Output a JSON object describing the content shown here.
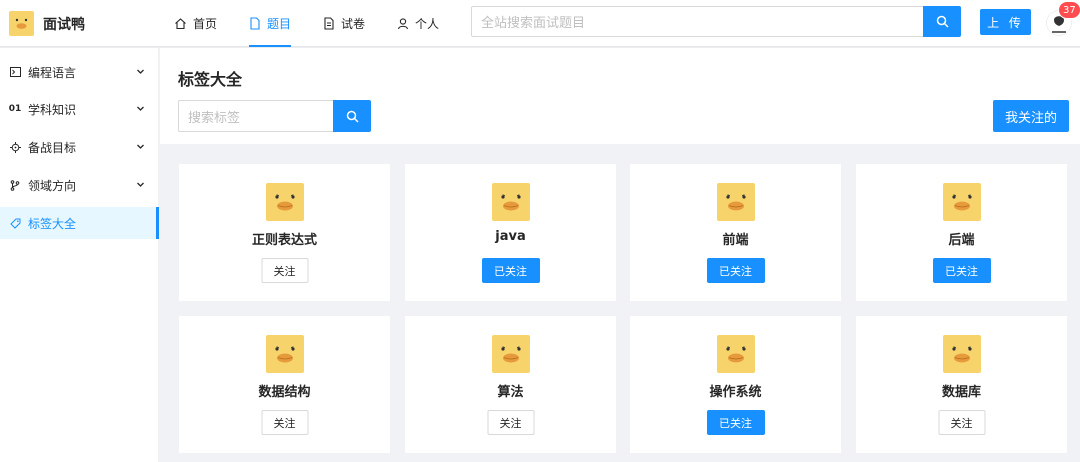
{
  "app": {
    "name": "面试鸭"
  },
  "nav": [
    {
      "label": "首页",
      "icon": "home-icon",
      "active": false
    },
    {
      "label": "题目",
      "icon": "file-icon",
      "active": true
    },
    {
      "label": "试卷",
      "icon": "paper-icon",
      "active": false
    },
    {
      "label": "个人",
      "icon": "user-icon",
      "active": false
    }
  ],
  "search": {
    "placeholder": "全站搜索面试题目"
  },
  "upload_label": "上 传",
  "notification_count": "37",
  "sidebar": [
    {
      "label": "编程语言",
      "icon": "terminal-icon",
      "expandable": true
    },
    {
      "label": "学科知识",
      "icon": "01",
      "expandable": true
    },
    {
      "label": "备战目标",
      "icon": "target-icon",
      "expandable": true
    },
    {
      "label": "领域方向",
      "icon": "branch-icon",
      "expandable": true
    },
    {
      "label": "标签大全",
      "icon": "tag-icon",
      "expandable": false,
      "active": true
    }
  ],
  "page_title": "标签大全",
  "tag_search": {
    "placeholder": "搜索标签"
  },
  "my_follows_label": "我关注的",
  "tags": [
    {
      "name": "正则表达式",
      "button": "关注",
      "followed": false
    },
    {
      "name": "java",
      "button": "已关注",
      "followed": true
    },
    {
      "name": "前端",
      "button": "已关注",
      "followed": true
    },
    {
      "name": "后端",
      "button": "已关注",
      "followed": true
    },
    {
      "name": "数据结构",
      "button": "关注",
      "followed": false
    },
    {
      "name": "算法",
      "button": "关注",
      "followed": false
    },
    {
      "name": "操作系统",
      "button": "已关注",
      "followed": true
    },
    {
      "name": "数据库",
      "button": "关注",
      "followed": false
    }
  ],
  "colors": {
    "primary": "#1890ff",
    "duck_yellow": "#f7d46b",
    "beak": "#e69a3c"
  }
}
